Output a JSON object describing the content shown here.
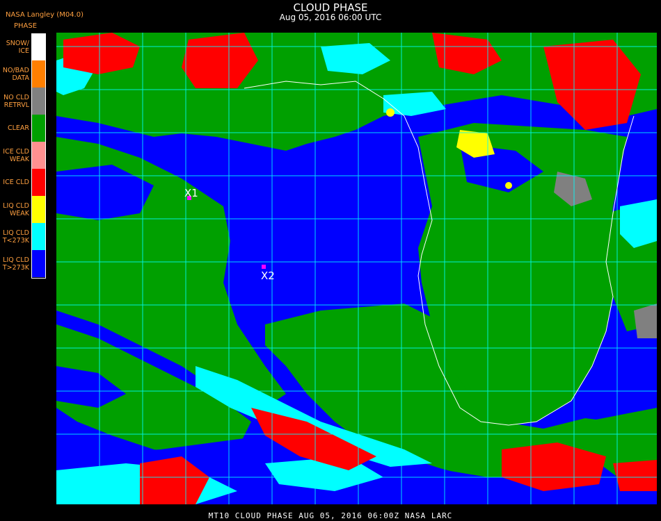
{
  "header": {
    "title": "CLOUD PHASE",
    "subtitle": "Aug 05, 2016 06:00 UTC",
    "provider": "NASA Langley (M04.0)",
    "legend_title": "PHASE"
  },
  "legend": [
    {
      "label": "SNOW/\nICE",
      "color": "#ffffff"
    },
    {
      "label": "NO/BAD\nDATA",
      "color": "#ff7f00"
    },
    {
      "label": "NO CLD\nRETRVL",
      "color": "#808080"
    },
    {
      "label": "CLEAR",
      "color": "#00a000"
    },
    {
      "label": "ICE CLD\nWEAK",
      "color": "#ff9090"
    },
    {
      "label": "ICE CLD",
      "color": "#ff0000"
    },
    {
      "label": "LIQ CLD\nWEAK",
      "color": "#ffff00"
    },
    {
      "label": "LIQ CLD\nT<273K",
      "color": "#00ffff"
    },
    {
      "label": "LIQ CLD\nT>273K",
      "color": "#0000ff"
    }
  ],
  "markers": [
    {
      "label": "X1",
      "color": "#ff00ff"
    },
    {
      "label": "X2",
      "color": "#ff00ff"
    }
  ],
  "footer": "MT10  CLOUD PHASE  AUG 05, 2016 06:00Z  NASA LARC",
  "grid_color": "#00ffff",
  "coast_color": "#ffffff"
}
